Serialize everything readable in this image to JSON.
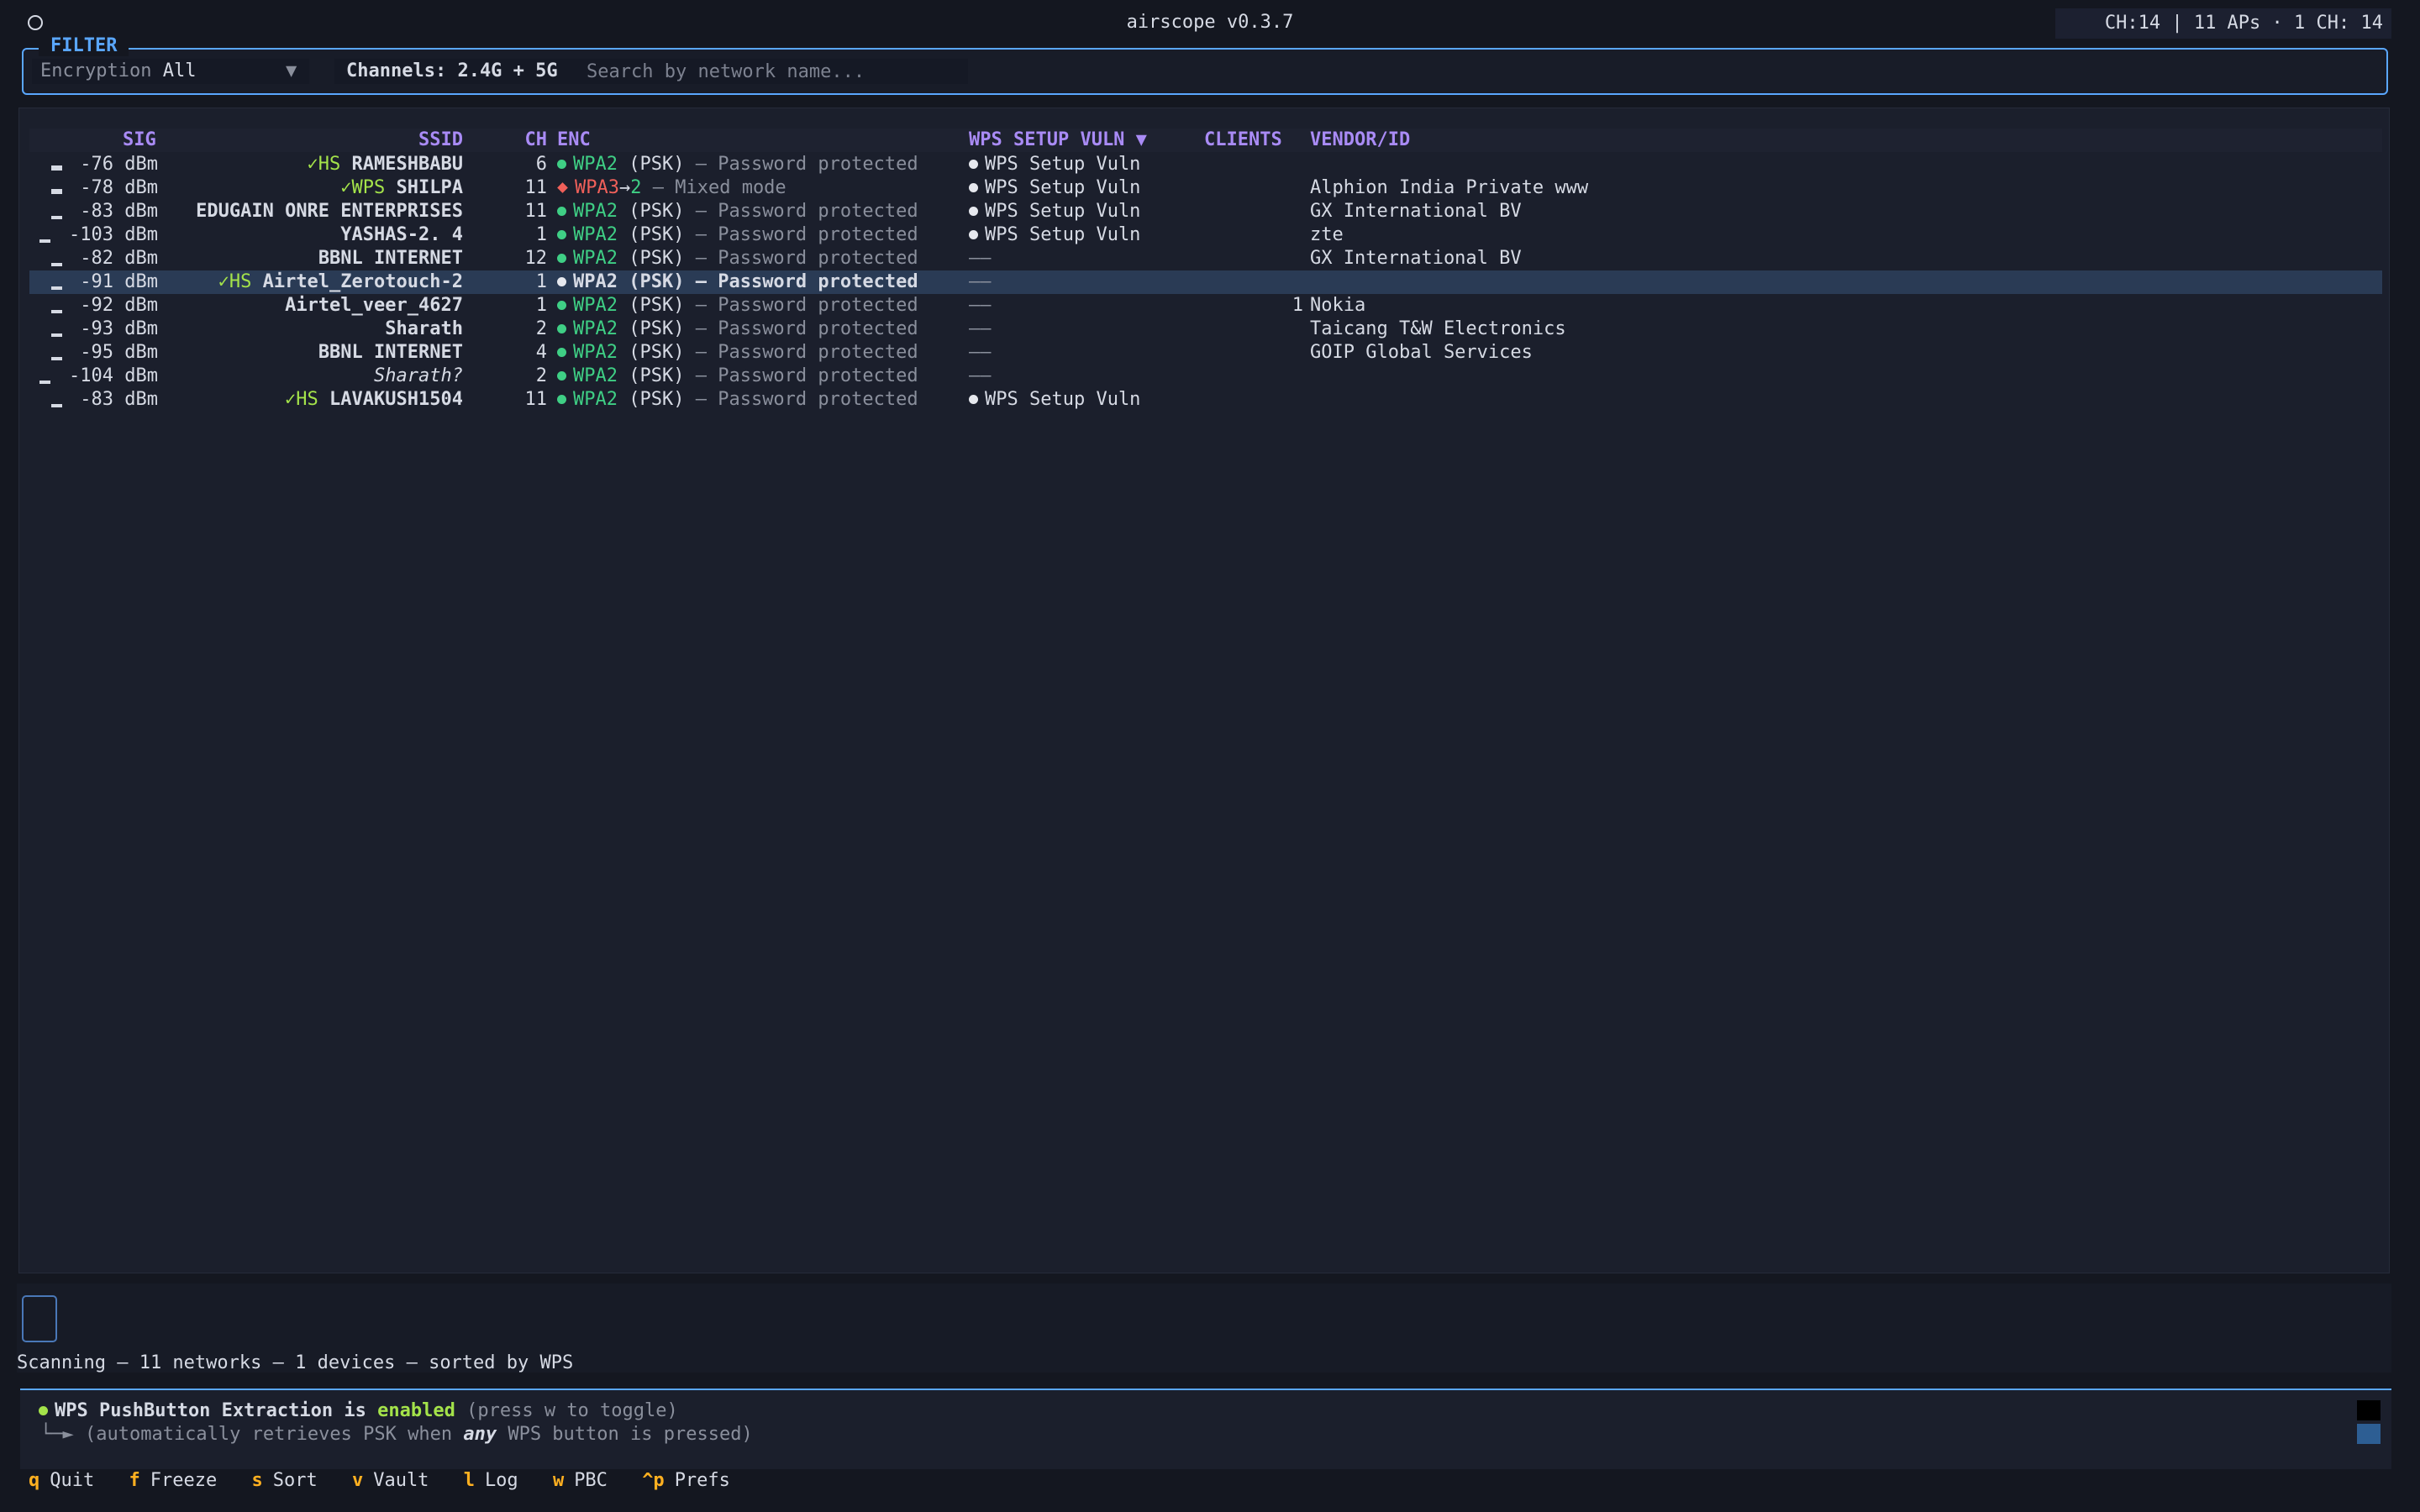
{
  "window": {
    "title": "airscope v0.3.7",
    "status_right": "CH:14 | 11 APs · 1  CH: 14"
  },
  "filter": {
    "legend": "FILTER",
    "encryption_label": "Encryption",
    "encryption_value": "All",
    "channels_label": "Channels: 2.4G + 5G",
    "search_placeholder": "Search by network name..."
  },
  "table": {
    "columns": {
      "sig": "SIG",
      "ssid": "SSID",
      "ch": "CH",
      "enc": "ENC",
      "wps": "WPS SETUP VULN ▼",
      "clients": "CLIENTS",
      "vendor": "VENDOR/ID"
    },
    "rows": [
      {
        "signal": "-76 dBm",
        "tag": "✓HS",
        "ssid": "RAMESHBABU",
        "ch": "6",
        "enc": "WPA2",
        "enc_mode": "(PSK)",
        "enc_desc": "– Password protected",
        "wps": "WPS Setup Vuln",
        "clients": "",
        "vendor": ""
      },
      {
        "signal": "-78 dBm",
        "tag": "✓WPS",
        "ssid": "SHILPA",
        "ch": "11",
        "enc": "WPA3",
        "enc_arrow": "→",
        "enc_alt": "2",
        "enc_mode": "",
        "enc_desc": "– Mixed mode",
        "wps": "WPS Setup Vuln",
        "clients": "",
        "vendor": "Alphion India Private www"
      },
      {
        "signal": "-83 dBm",
        "tag": "",
        "ssid": "EDUGAIN ONRE ENTERPRISES",
        "ch": "11",
        "enc": "WPA2",
        "enc_mode": "(PSK)",
        "enc_desc": "– Password protected",
        "wps": "WPS Setup Vuln",
        "clients": "",
        "vendor": "GX International BV"
      },
      {
        "signal": "-103 dBm",
        "tag": "",
        "ssid": "YASHAS-2. 4",
        "ch": "1",
        "enc": "WPA2",
        "enc_mode": "(PSK)",
        "enc_desc": "– Password protected",
        "wps": "WPS Setup Vuln",
        "clients": "",
        "vendor": "zte"
      },
      {
        "signal": "-82 dBm",
        "tag": "",
        "ssid": "BBNL INTERNET",
        "ch": "12",
        "enc": "WPA2",
        "enc_mode": "(PSK)",
        "enc_desc": "– Password protected",
        "wps": "––",
        "clients": "",
        "vendor": "GX International BV"
      },
      {
        "signal": "-91 dBm",
        "tag": "✓HS",
        "ssid": "Airtel_Zerotouch-2",
        "ch": "1",
        "enc": "WPA2",
        "enc_mode": "(PSK)",
        "enc_desc": "– Password protected",
        "wps": "––",
        "clients": "",
        "vendor": ""
      },
      {
        "signal": "-92 dBm",
        "tag": "",
        "ssid": "Airtel_veer_4627",
        "ch": "1",
        "enc": "WPA2",
        "enc_mode": "(PSK)",
        "enc_desc": "– Password protected",
        "wps": "––",
        "clients": "1",
        "vendor": "Nokia"
      },
      {
        "signal": "-93 dBm",
        "tag": "",
        "ssid": "Sharath",
        "ch": "2",
        "enc": "WPA2",
        "enc_mode": "(PSK)",
        "enc_desc": "– Password protected",
        "wps": "––",
        "clients": "",
        "vendor": "Taicang T&W Electronics"
      },
      {
        "signal": "-95 dBm",
        "tag": "",
        "ssid": "BBNL INTERNET",
        "ch": "4",
        "enc": "WPA2",
        "enc_mode": "(PSK)",
        "enc_desc": "– Password protected",
        "wps": "––",
        "clients": "",
        "vendor": "GOIP Global Services"
      },
      {
        "signal": "-104 dBm",
        "tag": "",
        "ssid": "Sharath?",
        "ch": "2",
        "enc": "WPA2",
        "enc_mode": "(PSK)",
        "enc_desc": "– Password protected",
        "wps": "––",
        "clients": "",
        "vendor": ""
      },
      {
        "signal": "-83 dBm",
        "tag": "✓HS",
        "ssid": "LAVAKUSH1504",
        "ch": "11",
        "enc": "WPA2",
        "enc_mode": "(PSK)",
        "enc_desc": "– Password protected",
        "wps": "WPS Setup Vuln",
        "clients": "",
        "vendor": ""
      }
    ]
  },
  "status_line": "Scanning – 11 networks – 1 devices – sorted by WPS",
  "info": {
    "feature": "WPS PushButton Extraction",
    "is": "is",
    "state": "enabled",
    "hint": "(press w to toggle)",
    "sub_prefix": "└─► (automatically retrieves PSK when",
    "sub_emph": "any",
    "sub_suffix": "WPS button is pressed)"
  },
  "footer": [
    {
      "key": "q",
      "label": "Quit"
    },
    {
      "key": "f",
      "label": "Freeze"
    },
    {
      "key": "s",
      "label": "Sort"
    },
    {
      "key": "v",
      "label": "Vault"
    },
    {
      "key": "l",
      "label": "Log"
    },
    {
      "key": "w",
      "label": "PBC"
    },
    {
      "key": "^p",
      "label": "Prefs"
    }
  ],
  "colors": {
    "accent_blue": "#5aa7ff",
    "header_purple": "#a98bf5",
    "wpa2_green": "#3fcf85",
    "tag_lime": "#a4e34a",
    "wpa3_red": "#f0605a",
    "key_orange": "#ffb020",
    "selected_row": "#2a3b55"
  },
  "selected_row": "Airtel_Zerotouch-2"
}
